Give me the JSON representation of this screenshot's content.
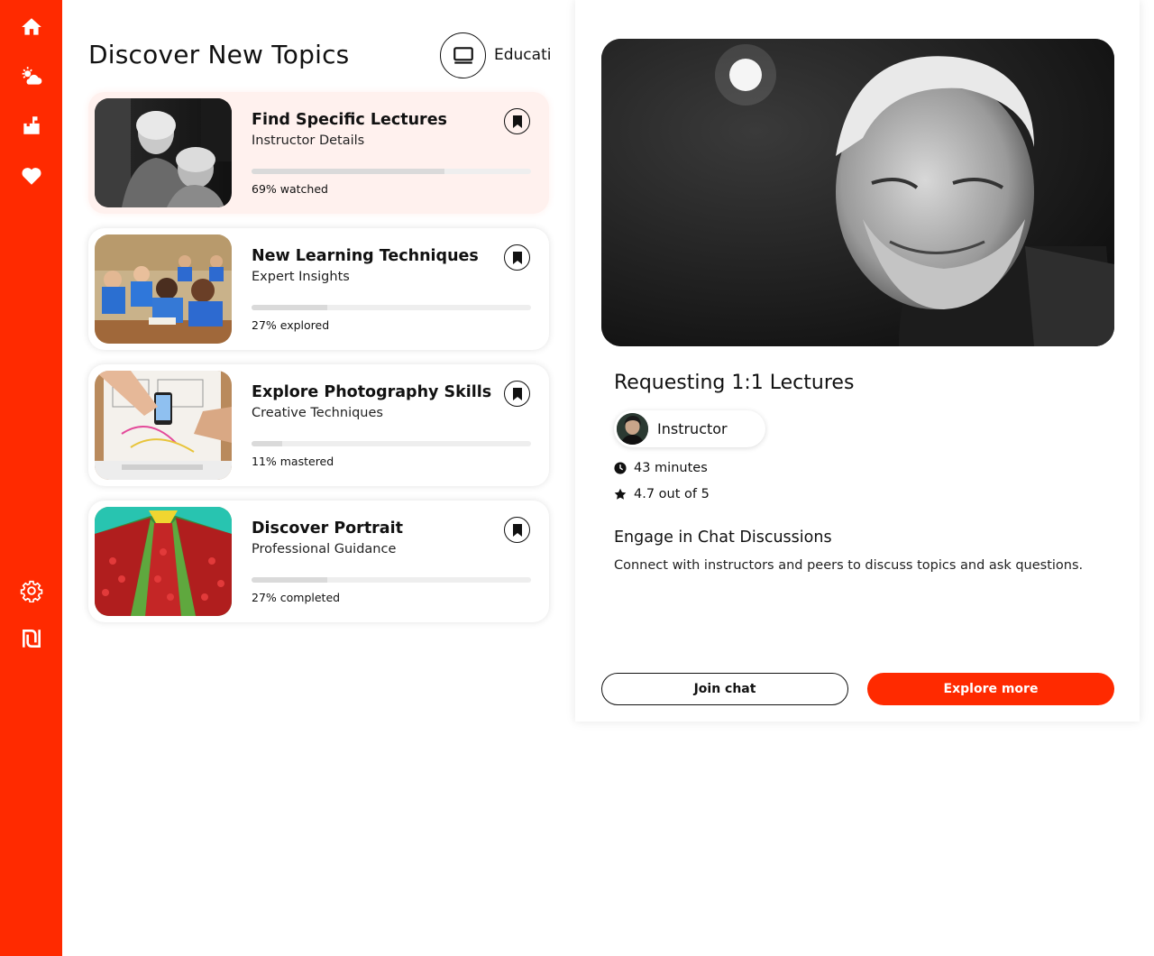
{
  "sidebar": {
    "top_items": [
      {
        "icon": "home-icon"
      },
      {
        "icon": "weather-icon"
      },
      {
        "icon": "mailbox-icon"
      },
      {
        "icon": "heart-icon"
      }
    ],
    "bottom_items": [
      {
        "icon": "gear-icon"
      },
      {
        "icon": "shekel-icon"
      }
    ]
  },
  "main": {
    "title": "Discover New Topics",
    "category": {
      "icon": "monitor-icon",
      "label": "Educati"
    },
    "cards": [
      {
        "title": "Find Specific Lectures",
        "subtitle": "Instructor Details",
        "progress": 0.69,
        "progress_text": "69% watched",
        "active": true
      },
      {
        "title": "New Learning Techniques",
        "subtitle": "Expert Insights",
        "progress": 0.27,
        "progress_text": "27% explored",
        "active": false
      },
      {
        "title": "Explore Photography Skills",
        "subtitle": "Creative Techniques",
        "progress": 0.11,
        "progress_text": "11% mastered",
        "active": false
      },
      {
        "title": "Discover Portrait",
        "subtitle": "Professional Guidance",
        "progress": 0.27,
        "progress_text": "27% completed",
        "active": false
      }
    ]
  },
  "detail": {
    "title": "Requesting 1:1 Lectures",
    "instructor_label": "Instructor",
    "duration": "43 minutes",
    "rating": "4.7 out of 5",
    "section_title": "Engage in Chat Discussions",
    "section_desc": "Connect with instructors and peers to discuss topics and ask questions.",
    "join_label": "Join chat",
    "explore_label": "Explore more"
  },
  "colors": {
    "accent": "#ff2a00",
    "active_card": "#fff1ee"
  }
}
